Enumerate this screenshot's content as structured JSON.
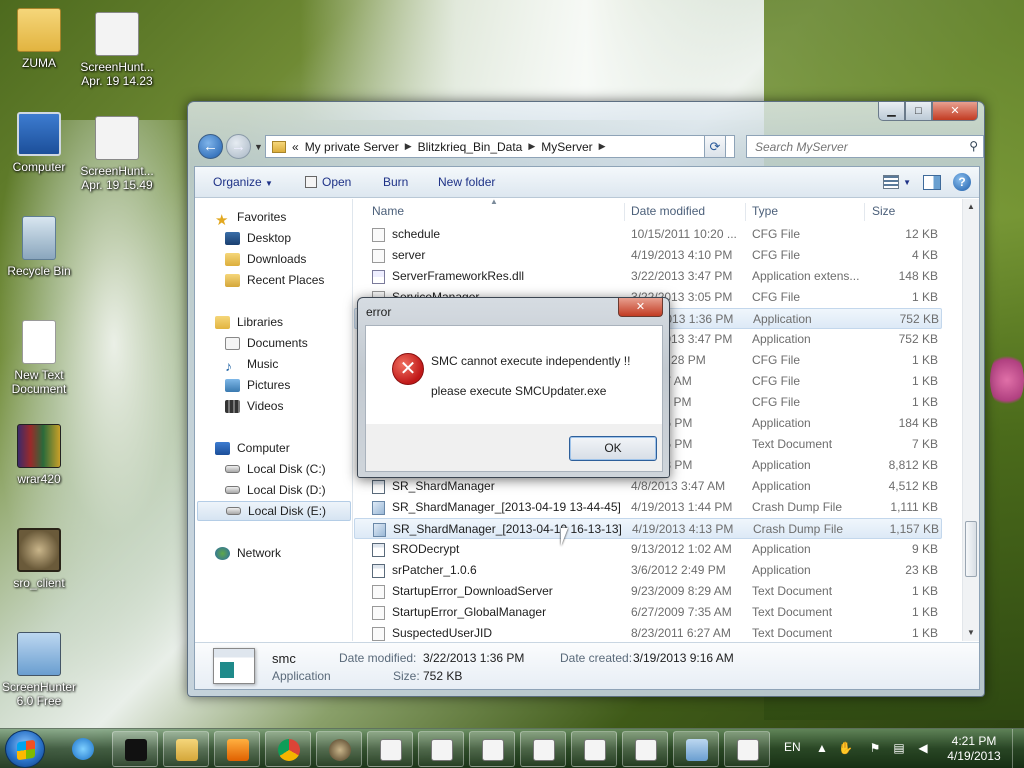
{
  "desktop": {
    "icons": [
      {
        "label": "ZUMA",
        "icon": "folder-user-icon"
      },
      {
        "label": "ScreenHunt...\nApr. 19 14.23",
        "icon": "screenshot-file-icon"
      },
      {
        "label": "Computer",
        "icon": "computer-icon"
      },
      {
        "label": "ScreenHunt...\nApr. 19 15.49",
        "icon": "screenshot-file-icon"
      },
      {
        "label": "Recycle Bin",
        "icon": "recycle-bin-icon"
      },
      {
        "label": "New Text\nDocument",
        "icon": "text-document-icon"
      },
      {
        "label": "wrar420",
        "icon": "winrar-icon"
      },
      {
        "label": "sro_client",
        "icon": "sro-client-icon"
      },
      {
        "label": "ScreenHunter\n6.0 Free",
        "icon": "screenhunter-icon"
      }
    ]
  },
  "explorer": {
    "caption_buttons": {
      "minimize": "▁",
      "maximize": "□",
      "close": "✕"
    },
    "address": {
      "prefix": "«",
      "crumbs": [
        "My private Server",
        "Blitzkrieq_Bin_Data",
        "MyServer"
      ]
    },
    "search": {
      "placeholder": "Search MyServer"
    },
    "toolbar": {
      "organize": "Organize",
      "open": "Open",
      "burn": "Burn",
      "new_folder": "New folder"
    },
    "nav": {
      "favorites": "Favorites",
      "desktop": "Desktop",
      "downloads": "Downloads",
      "recent": "Recent Places",
      "libraries": "Libraries",
      "documents": "Documents",
      "music": "Music",
      "pictures": "Pictures",
      "videos": "Videos",
      "computer": "Computer",
      "disk_c": "Local Disk (C:)",
      "disk_d": "Local Disk (D:)",
      "disk_e": "Local Disk (E:)",
      "network": "Network"
    },
    "columns": {
      "name": "Name",
      "date": "Date modified",
      "type": "Type",
      "size": "Size"
    },
    "files": [
      {
        "name": "schedule",
        "date": "10/15/2011 10:20 ...",
        "type": "CFG File",
        "size": "12 KB",
        "icon": "cfg"
      },
      {
        "name": "server",
        "date": "4/19/2013 4:10 PM",
        "type": "CFG File",
        "size": "4 KB",
        "icon": "cfg"
      },
      {
        "name": "ServerFrameworkRes.dll",
        "date": "3/22/2013 3:47 PM",
        "type": "Application extens...",
        "size": "148 KB",
        "icon": "dll"
      },
      {
        "name": "ServiceManager",
        "date": "3/22/2013 3:05 PM",
        "type": "CFG File",
        "size": "1 KB",
        "icon": "cfg"
      },
      {
        "name": "",
        "date": "3/22/2013 1:36 PM",
        "type": "Application",
        "size": "752 KB",
        "icon": "app",
        "selected": true
      },
      {
        "name": "",
        "date": "3/22/2013 3:47 PM",
        "type": "Application",
        "size": "752 KB",
        "icon": "app"
      },
      {
        "name": "",
        "date": "2004 5:28 PM",
        "type": "CFG File",
        "size": "1 KB",
        "icon": "cfg"
      },
      {
        "name": "",
        "date": "05 4:27 AM",
        "type": "CFG File",
        "size": "1 KB",
        "icon": "cfg"
      },
      {
        "name": "",
        "date": "11 3:39 PM",
        "type": "CFG File",
        "size": "1 KB",
        "icon": "cfg"
      },
      {
        "name": "",
        "date": "13 1:36 PM",
        "type": "Application",
        "size": "184 KB",
        "icon": "app"
      },
      {
        "name": "",
        "date": "13 9:35 PM",
        "type": "Text Document",
        "size": "7 KB",
        "icon": "cfg"
      },
      {
        "name": "",
        "date": "13 7:38 PM",
        "type": "Application",
        "size": "8,812 KB",
        "icon": "app"
      },
      {
        "name": "SR_ShardManager",
        "date": "4/8/2013 3:47 AM",
        "type": "Application",
        "size": "4,512 KB",
        "icon": "app"
      },
      {
        "name": "SR_ShardManager_[2013-04-19 13-44-45]",
        "date": "4/19/2013 1:44 PM",
        "type": "Crash Dump File",
        "size": "1,111 KB",
        "icon": "dmp"
      },
      {
        "name": "SR_ShardManager_[2013-04-19 16-13-13]",
        "date": "4/19/2013 4:13 PM",
        "type": "Crash Dump File",
        "size": "1,157 KB",
        "icon": "dmp",
        "hover": true
      },
      {
        "name": "SRODecrypt",
        "date": "9/13/2012 1:02 AM",
        "type": "Application",
        "size": "9 KB",
        "icon": "app"
      },
      {
        "name": "srPatcher_1.0.6",
        "date": "3/6/2012 2:49 PM",
        "type": "Application",
        "size": "23 KB",
        "icon": "app"
      },
      {
        "name": "StartupError_DownloadServer",
        "date": "9/23/2009 8:29 AM",
        "type": "Text Document",
        "size": "1 KB",
        "icon": "cfg"
      },
      {
        "name": "StartupError_GlobalManager",
        "date": "6/27/2009 7:35 AM",
        "type": "Text Document",
        "size": "1 KB",
        "icon": "cfg"
      },
      {
        "name": "SuspectedUserJID",
        "date": "8/23/2011 6:27 AM",
        "type": "Text Document",
        "size": "1 KB",
        "icon": "cfg"
      }
    ],
    "details": {
      "name": "smc",
      "kind": "Application",
      "modified_label": "Date modified:",
      "modified": "3/22/2013 1:36 PM",
      "created_label": "Date created:",
      "created": "3/19/2013 9:16 AM",
      "size_label": "Size:",
      "size": "752 KB"
    }
  },
  "dialog": {
    "title": "error",
    "close": "✕",
    "line1": "SMC cannot execute independently !!",
    "line2": "please execute SMCUpdater.exe",
    "ok": "OK"
  },
  "taskbar": {
    "language": "EN",
    "time": "4:21 PM",
    "date": "4/19/2013",
    "pinned": [
      "command-prompt-icon",
      "explorer-icon",
      "media-player-icon",
      "chrome-icon",
      "sro-client-icon",
      "document-icon",
      "document-icon",
      "document-icon",
      "document-icon",
      "document-icon",
      "document-icon",
      "screenhunter-icon",
      "document-icon"
    ]
  }
}
